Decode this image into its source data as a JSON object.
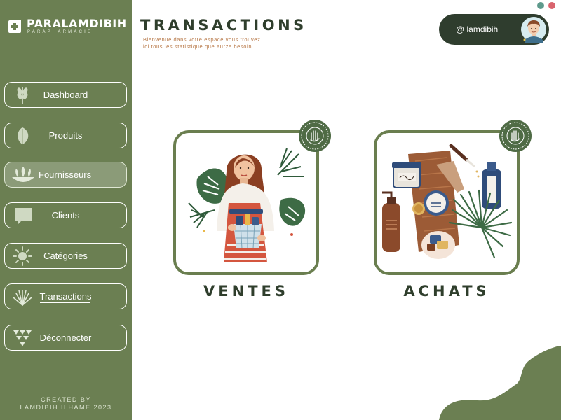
{
  "app": {
    "brand_name": "PARALAMDIBIH",
    "brand_tagline": "PARAPHARMACIE"
  },
  "colors": {
    "sidebar": "#6b7f52",
    "title": "#2f3e2c",
    "subtitle": "#b77746",
    "user_pill": "#2f3d2e",
    "card_border": "#6a7e4f",
    "window_dot_1": "#5e9a8c",
    "window_dot_2": "#d9646e"
  },
  "sidebar": {
    "items": [
      {
        "label": "Dashboard",
        "icon": "wheat-icon",
        "active": false
      },
      {
        "label": "Produits",
        "icon": "leaf-icon",
        "active": false
      },
      {
        "label": "Fournisseurs",
        "icon": "plant-pot-icon",
        "active": true
      },
      {
        "label": "Clients",
        "icon": "speech-bubble-icon",
        "active": false
      },
      {
        "label": "Catégories",
        "icon": "sun-icon",
        "active": false
      },
      {
        "label": "Transactions",
        "icon": "fern-icon",
        "active": false,
        "underlined": true
      },
      {
        "label": "Déconnecter",
        "icon": "triangles-icon",
        "active": false
      }
    ],
    "credit_line1": "CREATED BY",
    "credit_line2": "LAMDIBIH ILHAME 2023"
  },
  "header": {
    "title": "TRANSACTIONS",
    "subtitle": "Bienvenue dans votre espace vous trouvez ici tous les statistique que aurze besoin"
  },
  "user": {
    "handle": "@ lamdibih"
  },
  "cards": [
    {
      "label": "VENTES",
      "illustration": "woman-holding-basket-illustration",
      "badge": "hypoallergenic-badge-icon"
    },
    {
      "label": "ACHATS",
      "illustration": "cosmetics-products-illustration",
      "badge": "hypoallergenic-badge-icon"
    }
  ]
}
